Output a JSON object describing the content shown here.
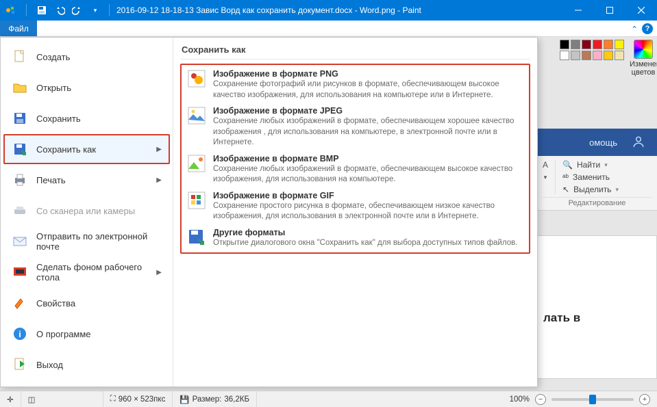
{
  "titlebar": {
    "title": "2016-09-12 18-18-13 Завис Ворд как сохранить документ.docx - Word.png - Paint"
  },
  "file_tab": "Файл",
  "swatch_colors": [
    "#000000",
    "#7f7f7f",
    "#880015",
    "#ed1c24",
    "#ff7f27",
    "#fff200",
    "#ffffff",
    "#c3c3c3",
    "#b97a57",
    "#ffaec9",
    "#ffc90e",
    "#efe4b0"
  ],
  "edit_colors_label": "Изменение цветов",
  "word": {
    "tab_help": "омощь",
    "find": "Найти",
    "replace": "Заменить",
    "select": "Выделить",
    "group": "Редактирование",
    "canvas_fragment": "лать в"
  },
  "filemenu": {
    "items": [
      {
        "key": "new",
        "label": "Создать"
      },
      {
        "key": "open",
        "label": "Открыть"
      },
      {
        "key": "save",
        "label": "Сохранить"
      },
      {
        "key": "saveas",
        "label": "Сохранить как",
        "arrow": true,
        "highlight": true
      },
      {
        "key": "print",
        "label": "Печать",
        "arrow": true
      },
      {
        "key": "scanner",
        "label": "Со сканера или камеры",
        "disabled": true
      },
      {
        "key": "email",
        "label": "Отправить по электронной почте"
      },
      {
        "key": "wallpaper",
        "label": "Сделать фоном рабочего стола",
        "arrow": true
      },
      {
        "key": "props",
        "label": "Свойства"
      },
      {
        "key": "about",
        "label": "О программе"
      },
      {
        "key": "exit",
        "label": "Выход"
      }
    ],
    "right_header": "Сохранить как",
    "formats": [
      {
        "key": "png",
        "title": "Изображение в формате PNG",
        "desc": "Сохранение фотографий или рисунков в формате, обеспечивающем высокое качество изображения, для использования на компьютере или в Интернете."
      },
      {
        "key": "jpeg",
        "title": "Изображение в формате JPEG",
        "desc": "Сохранение любых изображений в формате, обеспечивающем хорошее качество изображения , для использования на компьютере, в электронной почте или в Интернете."
      },
      {
        "key": "bmp",
        "title": "Изображение в формате BMP",
        "desc": "Сохранение любых изображений в формате, обеспечивающем высокое качество изображения, для использования на компьютере."
      },
      {
        "key": "gif",
        "title": "Изображение в формате GIF",
        "desc": "Сохранение простого рисунка в формате, обеспечивающем низкое качество изображения, для использования в электронной почте или в Интернете."
      },
      {
        "key": "other",
        "title": "Другие форматы",
        "desc": "Открытие диалогового окна \"Сохранить как\" для выбора доступных типов файлов."
      }
    ]
  },
  "statusbar": {
    "dims": "960 × 523пкс",
    "size_label": "Размер:",
    "size_value": "36,2КБ",
    "zoom": "100%"
  }
}
